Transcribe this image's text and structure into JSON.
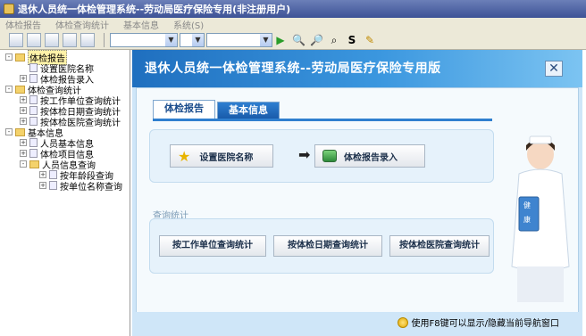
{
  "window": {
    "title": "退休人员统一体检管理系统--劳动局医疗保险专用(非注册用户)"
  },
  "menu": {
    "items": [
      "体检报告",
      "体检查询统计",
      "基本信息",
      "系统(S)"
    ]
  },
  "tree": {
    "nodes": [
      {
        "label": "体检报告",
        "level": 0,
        "expander": "-",
        "icon": "folder-open-icon",
        "selected": true
      },
      {
        "label": "设置医院名称",
        "level": 1,
        "expander": "",
        "icon": "document-icon"
      },
      {
        "label": "体检报告录入",
        "level": 1,
        "expander": "+",
        "icon": "document-icon"
      },
      {
        "label": "体检查询统计",
        "level": 0,
        "expander": "-",
        "icon": "folder-open-icon"
      },
      {
        "label": "按工作单位查询统计",
        "level": 1,
        "expander": "+",
        "icon": "document-icon"
      },
      {
        "label": "按体检日期查询统计",
        "level": 1,
        "expander": "+",
        "icon": "document-icon"
      },
      {
        "label": "按体检医院查询统计",
        "level": 1,
        "expander": "+",
        "icon": "document-icon"
      },
      {
        "label": "基本信息",
        "level": 0,
        "expander": "-",
        "icon": "folder-open-icon"
      },
      {
        "label": "人员基本信息",
        "level": 1,
        "expander": "+",
        "icon": "document-icon"
      },
      {
        "label": "体检项目信息",
        "level": 1,
        "expander": "+",
        "icon": "document-icon"
      },
      {
        "label": "人员信息查询",
        "level": 1,
        "expander": "-",
        "icon": "folder-open-icon"
      },
      {
        "label": "按年龄段查询",
        "level": 2,
        "expander": "+",
        "icon": "document-icon"
      },
      {
        "label": "按单位名称查询",
        "level": 2,
        "expander": "+",
        "icon": "document-icon"
      }
    ]
  },
  "main": {
    "title": "退休人员统一体检管理系统--劳动局医疗保险专用版",
    "tabs": [
      {
        "label": "体检报告",
        "active": true
      },
      {
        "label": "基本信息",
        "active": false
      }
    ],
    "report_actions": {
      "set_hospital": "设置医院名称",
      "enter_report": "体检报告录入"
    },
    "query_section_label": "查询统计",
    "query_buttons": [
      "按工作单位查询统计",
      "按体检日期查询统计",
      "按体检医院查询统计"
    ],
    "nurse_sign": "健康"
  },
  "footer": {
    "hint": "使用F8键可以显示/隐藏当前导航窗口"
  },
  "colors": {
    "header_blue": "#2a7fd0",
    "tab_active_text": "#1a4c8c",
    "panel_bg": "#e6f2fb"
  }
}
